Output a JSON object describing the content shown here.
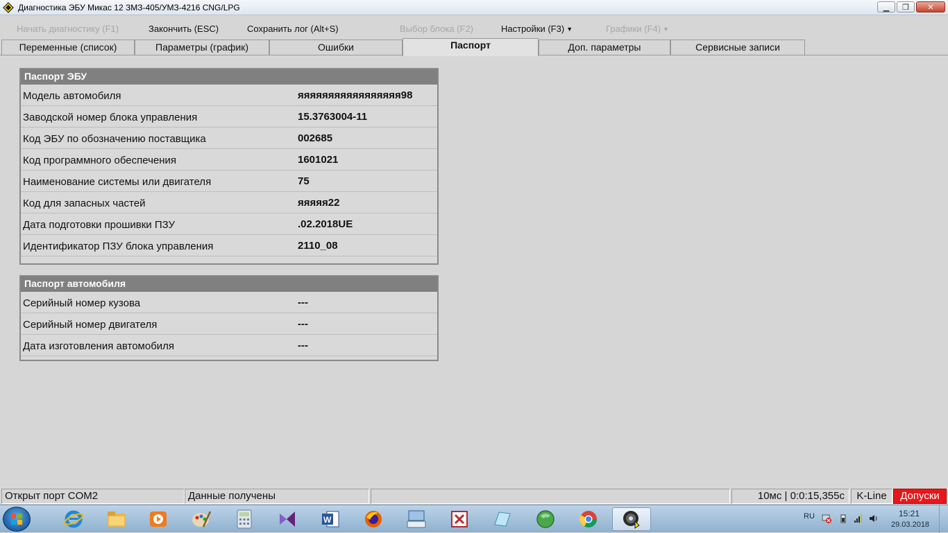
{
  "window": {
    "title": "Диагностика ЭБУ Микас 12 ЗМЗ-405/УМЗ-4216 CNG/LPG"
  },
  "toolbar": {
    "start_diag": "Начать диагностику (F1)",
    "finish": "Закончить (ESC)",
    "save_log": "Сохранить лог (Alt+S)",
    "select_block": "Выбор блока (F2)",
    "settings": "Настройки (F3)",
    "graphs": "Графики (F4)"
  },
  "tabs": [
    {
      "label": "Переменные (список)"
    },
    {
      "label": "Параметры (график)"
    },
    {
      "label": "Ошибки"
    },
    {
      "label": "Паспорт"
    },
    {
      "label": "Доп. параметры"
    },
    {
      "label": "Сервисные записи"
    }
  ],
  "ecu_passport": {
    "title": "Паспорт ЭБУ",
    "rows": [
      {
        "label": "Модель автомобиля",
        "value": "яяяяяяяяяяяяяяяяя98"
      },
      {
        "label": "Заводской номер блока управления",
        "value": "15.3763004-11"
      },
      {
        "label": "Код ЭБУ по обозначению поставщика",
        "value": "002685"
      },
      {
        "label": "Код программного обеспечения",
        "value": "1601021"
      },
      {
        "label": "Наименование системы или двигателя",
        "value": "75"
      },
      {
        "label": "Код для запасных частей",
        "value": "яяяяя22"
      },
      {
        "label": "Дата подготовки прошивки ПЗУ",
        "value": ".02.2018UE"
      },
      {
        "label": "Идентификатор ПЗУ блока управления",
        "value": "2110_08"
      }
    ]
  },
  "vehicle_passport": {
    "title": "Паспорт автомобиля",
    "rows": [
      {
        "label": "Серийный номер кузова",
        "value": "---"
      },
      {
        "label": "Серийный номер двигателя",
        "value": "---"
      },
      {
        "label": "Дата изготовления автомобиля",
        "value": "---"
      }
    ]
  },
  "statusbar": {
    "port": "Открыт порт COM2",
    "data": "Данные получены",
    "empty": "",
    "timing": "10мс | 0:0:15,355с",
    "protocol": "K-Line",
    "alert": "Допуски"
  },
  "taskbar": {
    "apps": [
      "internet-explorer-icon",
      "file-explorer-icon",
      "media-player-icon",
      "paint-icon",
      "calculator-icon",
      "visual-studio-icon",
      "word-icon",
      "firefox-icon",
      "keyboard-icon",
      "pdf-reader-icon",
      "notepad-icon",
      "globe-icon",
      "chrome-icon",
      "diagnostics-app-icon"
    ],
    "lang": "RU",
    "time": "15:21",
    "date": "29.03.2018"
  },
  "colors": {
    "panel_header": "#808080",
    "alert_bg": "#e8171a",
    "window_bg": "#d6d6d6"
  }
}
